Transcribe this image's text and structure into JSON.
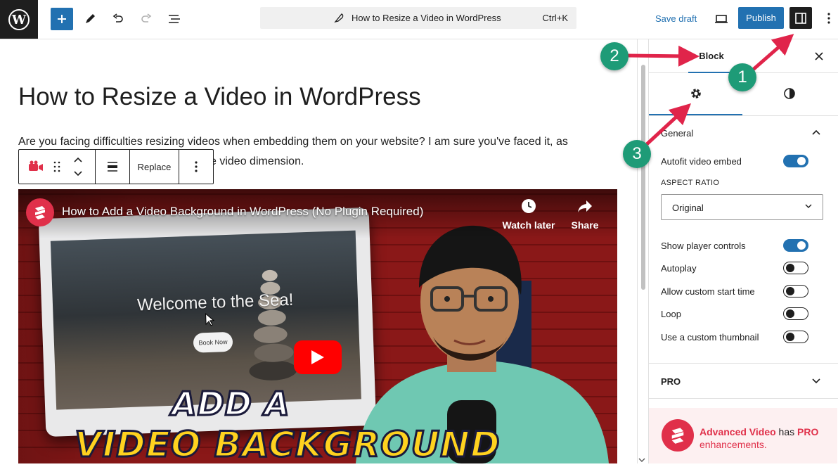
{
  "topbar": {
    "command_title": "How to Resize a Video in WordPress",
    "command_shortcut": "Ctrl+K",
    "save_draft": "Save draft",
    "publish": "Publish"
  },
  "post": {
    "title": "How to Resize a Video in WordPress",
    "paragraph_line1": "Are you facing difficulties resizing videos when embedding them on your website? I am sure you've faced it, as",
    "paragraph_line2": "e video dimension."
  },
  "block_toolbar": {
    "replace": "Replace"
  },
  "video": {
    "title": "How to Add a Video Background in WordPress (No Plugin Required)",
    "watch_later": "Watch later",
    "share": "Share",
    "laptop_heading": "Welcome to the Sea!",
    "laptop_button": "Book Now",
    "headline_1": "ADD A",
    "headline_2": "VIDEO BACKGROUND"
  },
  "sidebar": {
    "tab_block": "Block",
    "panel_general": "General",
    "autofit": "Autofit video embed",
    "aspect_ratio_label": "ASPECT RATIO",
    "aspect_ratio_value": "Original",
    "show_controls": "Show player controls",
    "autoplay": "Autoplay",
    "custom_start": "Allow custom start time",
    "loop": "Loop",
    "custom_thumbnail": "Use a custom thumbnail",
    "panel_pro": "PRO",
    "promo_name": "Advanced Video",
    "promo_has": " has ",
    "promo_pro": "PRO",
    "promo_rest": "enhancements."
  },
  "toggles": {
    "autofit": true,
    "show_controls": true,
    "autoplay": false,
    "custom_start": false,
    "loop": false,
    "custom_thumbnail": false
  },
  "annotations": {
    "badge1": "1",
    "badge2": "2",
    "badge3": "3"
  },
  "colors": {
    "accent": "#2271b1",
    "brand_red": "#e0304a",
    "annotation_green": "#1e9b77",
    "annotation_arrow": "#e0244a"
  }
}
